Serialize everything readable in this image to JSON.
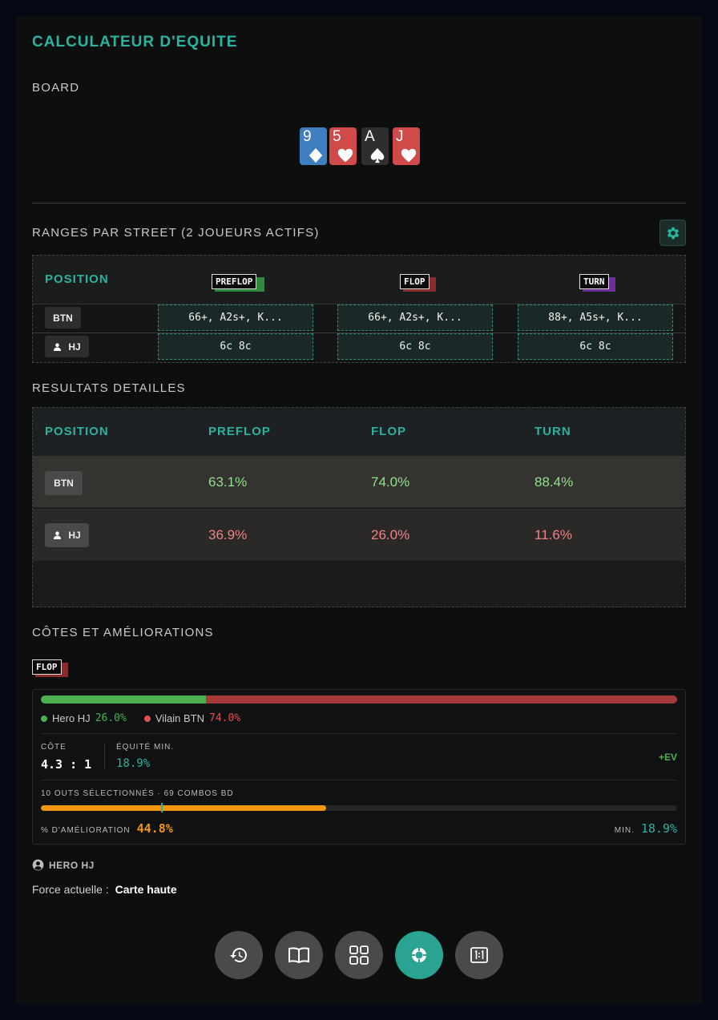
{
  "app": {
    "title": "CALCULATEUR D'EQUITE"
  },
  "board": {
    "label": "BOARD",
    "cards": [
      {
        "rank": "9",
        "suit": "diamond",
        "color": "#3f7fbf"
      },
      {
        "rank": "5",
        "suit": "heart",
        "color": "#d04a4a"
      },
      {
        "rank": "A",
        "suit": "spade",
        "color": "#2e2e2e"
      },
      {
        "rank": "J",
        "suit": "heart",
        "color": "#d04a4a"
      }
    ]
  },
  "ranges": {
    "label": "RANGES PAR STREET (2 JOUEURS ACTIFS)",
    "settings_icon": "gear-icon",
    "header": {
      "position": "POSITION",
      "streets": [
        "PREFLOP",
        "FLOP",
        "TURN"
      ]
    },
    "street_colors": {
      "PREFLOP": "#2e8b3e",
      "FLOP": "#8b2a2a",
      "TURN": "#6b2e9a"
    },
    "rows": [
      {
        "position": "BTN",
        "hero": false,
        "cells": [
          "66+, A2s+, K...",
          "66+, A2s+, K...",
          "88+, A5s+, K..."
        ]
      },
      {
        "position": "HJ",
        "hero": true,
        "cells": [
          "6c 8c",
          "6c 8c",
          "6c 8c"
        ]
      }
    ]
  },
  "results": {
    "label": "RESULTATS DETAILLES",
    "header": [
      "POSITION",
      "PREFLOP",
      "FLOP",
      "TURN"
    ],
    "rows": [
      {
        "position": "BTN",
        "hero": false,
        "values": [
          "63.1%",
          "74.0%",
          "88.4%"
        ]
      },
      {
        "position": "HJ",
        "hero": true,
        "values": [
          "36.9%",
          "26.0%",
          "11.6%"
        ]
      }
    ]
  },
  "odds": {
    "label": "CÔTES ET AMÉLIORATIONS",
    "street_tag": "FLOP",
    "equity_bar": {
      "hero_fraction": 0.26,
      "hero_color": "#4caf50",
      "villain_color": "#a63a3a"
    },
    "hero_legend": {
      "label": "Hero HJ",
      "value": "26.0%"
    },
    "villain_legend": {
      "label": "Vilain BTN",
      "value": "74.0%"
    },
    "cote": {
      "label": "CÔTE",
      "value": "4.3 : 1"
    },
    "equity_min": {
      "label": "ÉQUITÉ MIN.",
      "value": "18.9%"
    },
    "ev_badge": "+EV",
    "outs_text": "10 OUTS SÉLECTIONNÉS · 69 COMBOS BD",
    "improve_bar": {
      "fraction": 0.448,
      "marker_fraction": 0.189,
      "color": "#f0960f"
    },
    "improvement": {
      "label": "% D'AMÉLIORATION",
      "value": "44.8%"
    },
    "min": {
      "label": "MIN.",
      "value": "18.9%"
    }
  },
  "hero": {
    "title": "HERO HJ",
    "force_label": "Force actuelle :",
    "force_value": "Carte haute"
  },
  "bottom_nav": [
    {
      "icon": "history-icon",
      "active": false
    },
    {
      "icon": "book-icon",
      "active": false
    },
    {
      "icon": "grid-icon",
      "active": false
    },
    {
      "icon": "chip-icon",
      "active": true
    },
    {
      "icon": "one-to-one-icon",
      "active": false
    }
  ]
}
